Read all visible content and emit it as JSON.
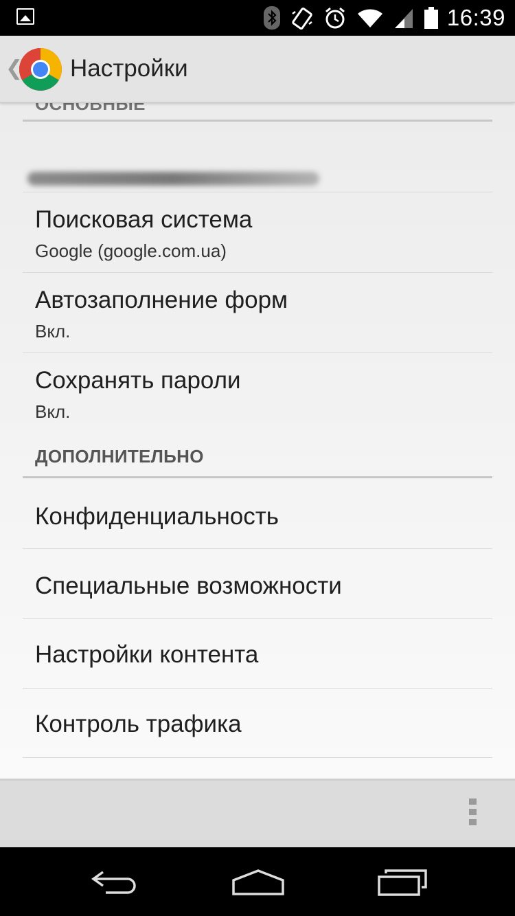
{
  "status_bar": {
    "time": "16:39",
    "icons": [
      "gallery-icon",
      "bluetooth-icon",
      "vibrate-icon",
      "alarm-icon",
      "wifi-icon",
      "signal-icon",
      "battery-icon"
    ]
  },
  "action_bar": {
    "title": "Настройки",
    "icon": "chrome-logo"
  },
  "settings": {
    "section_basic_partial": "ОСНОВНЫЕ",
    "account": "",
    "search_engine": {
      "title": "Поисковая система",
      "value": "Google (google.com.ua)"
    },
    "autofill": {
      "title": "Автозаполнение форм",
      "value": "Вкл."
    },
    "save_passwords": {
      "title": "Сохранять пароли",
      "value": "Вкл."
    },
    "section_advanced": "ДОПОЛНИТЕЛЬНО",
    "privacy": {
      "title": "Конфиденциальность"
    },
    "accessibility": {
      "title": "Специальные возможности"
    },
    "content_settings": {
      "title": "Настройки контента"
    },
    "bandwidth": {
      "title": "Контроль трафика"
    }
  },
  "bottom_bar": {
    "menu_icon": "overflow-menu-icon"
  },
  "nav_bar": {
    "buttons": [
      "back-icon",
      "home-icon",
      "recents-icon"
    ]
  },
  "colors": {
    "status_bar": "#000000",
    "action_bar": "#e4e4e4",
    "background": "#f2f2f2",
    "text": "#1f1f1f",
    "section_header": "#555555"
  }
}
